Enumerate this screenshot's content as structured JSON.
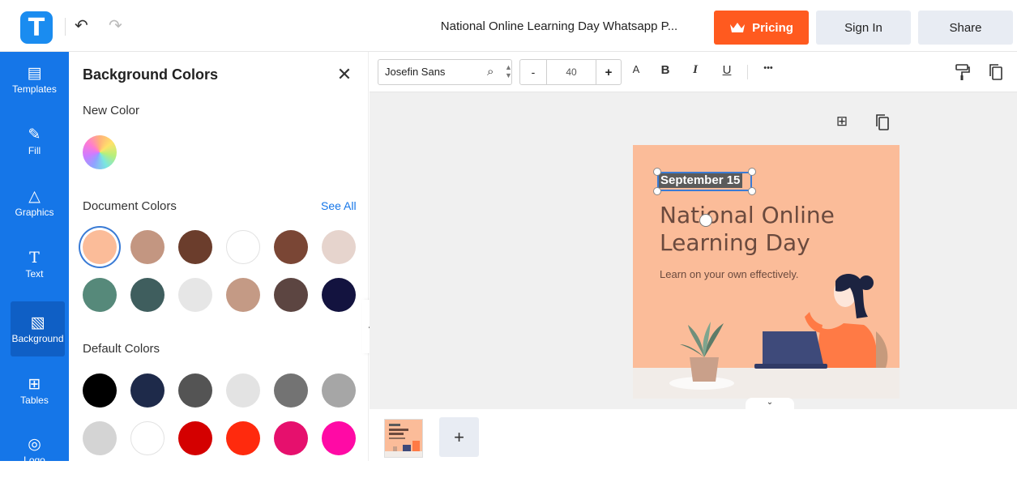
{
  "header": {
    "logo_letter": "T",
    "doc_title": "National Online Learning Day Whatsapp P...",
    "pricing_label": "Pricing",
    "signin_label": "Sign In",
    "share_label": "Share"
  },
  "sidebar": {
    "items": [
      {
        "label": "Templates",
        "icon": "templates-icon"
      },
      {
        "label": "Fill",
        "icon": "pencil-icon"
      },
      {
        "label": "Graphics",
        "icon": "shapes-icon"
      },
      {
        "label": "Text",
        "icon": "text-icon"
      },
      {
        "label": "Background",
        "icon": "background-icon"
      },
      {
        "label": "Tables",
        "icon": "table-icon"
      },
      {
        "label": "Logo",
        "icon": "logo-icon"
      }
    ],
    "active": "Background"
  },
  "panel": {
    "title": "Background Colors",
    "new_color_label": "New Color",
    "document_colors_label": "Document Colors",
    "see_all_label": "See All",
    "default_colors_label": "Default Colors",
    "document_colors": [
      "#fbbc99",
      "#c39681",
      "#6b3d2c",
      "#ffffff",
      "#7a4635",
      "#e6d4cd",
      "#56897a",
      "#3f5e5e",
      "#e6e6e6",
      "#c49a85",
      "#5c4541",
      "#13133f"
    ],
    "selected_document_color": "#fbbc99",
    "default_colors": [
      "#000000",
      "#1e2a4a",
      "#545454",
      "#e3e3e3",
      "#737373",
      "#a6a6a6",
      "#d4d4d4",
      "#ffffff",
      "#d40000",
      "#ff2a0d",
      "#e6106d",
      "#ff0aa5"
    ]
  },
  "toolbar": {
    "font_name": "Josefin Sans",
    "font_size": "40",
    "minus": "-",
    "plus": "+",
    "font_color": "A",
    "bold": "B",
    "italic": "I",
    "underline": "U",
    "more": "•••"
  },
  "canvas": {
    "date_text": "September 15",
    "title_line1": "National Online",
    "title_line2": "Learning Day",
    "subtitle": "Learn on your own effectively.",
    "background_color": "#fbbc99"
  },
  "pages": {
    "add_label": "+"
  }
}
